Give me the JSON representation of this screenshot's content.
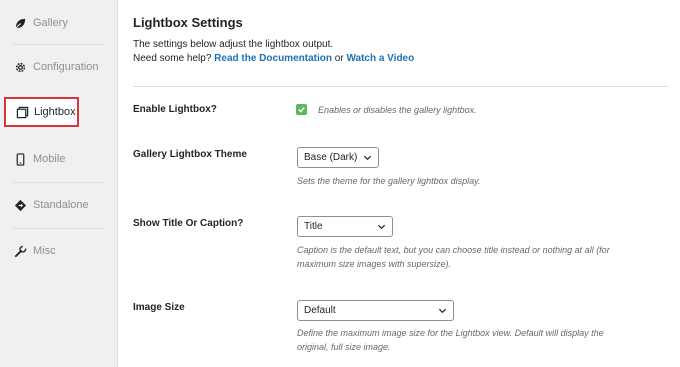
{
  "sidebar": {
    "items": [
      {
        "label": "Gallery",
        "icon": "leaf-icon"
      },
      {
        "label": "Configuration",
        "icon": "gear-icon"
      },
      {
        "label": "Lightbox",
        "icon": "lightbox-icon"
      },
      {
        "label": "Mobile",
        "icon": "mobile-icon"
      },
      {
        "label": "Standalone",
        "icon": "standalone-icon"
      },
      {
        "label": "Misc",
        "icon": "wrench-icon"
      }
    ],
    "active": "Lightbox"
  },
  "main": {
    "title": "Lightbox Settings",
    "desc_line1": "The settings below adjust the lightbox output.",
    "desc_help_prefix": "Need some help?",
    "docs_link": "Read the Documentation",
    "or_text": "or",
    "video_link": "Watch a Video"
  },
  "settings": {
    "enable": {
      "label": "Enable Lightbox?",
      "checked": true,
      "hint": "Enables or disables the gallery lightbox."
    },
    "theme": {
      "label": "Gallery Lightbox Theme",
      "value": "Base (Dark)",
      "hint": "Sets the theme for the gallery lightbox display."
    },
    "title_caption": {
      "label": "Show Title Or Caption?",
      "value": "Title",
      "hint_line1": "Caption is the default text, but you can choose title instead or nothing at all (for",
      "hint_line2": "maximum size images with supersize)."
    },
    "image_size": {
      "label": "Image Size",
      "value": "Default",
      "hint_line1": "Define the maximum image size for the Lightbox view. Default will display the",
      "hint_line2": "original, full size image."
    }
  },
  "colors": {
    "accent": "#2271b1",
    "highlight": "#d63638",
    "check": "#5cb85c"
  }
}
